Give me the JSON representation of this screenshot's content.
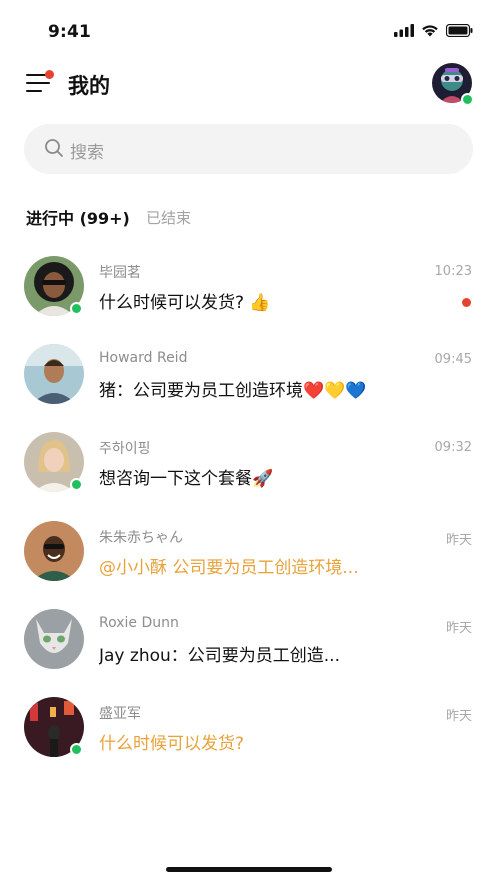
{
  "status_bar": {
    "time": "9:41",
    "icons": [
      "signal-icon",
      "wifi-icon",
      "battery-icon"
    ]
  },
  "header": {
    "title": "我的",
    "menu_icon": "menu-icon",
    "has_notification_dot": true,
    "avatar_online": true
  },
  "search": {
    "placeholder": "搜索",
    "icon": "search-icon"
  },
  "tabs": [
    {
      "label": "进行中 (99+)",
      "active": true
    },
    {
      "label": "已结束",
      "active": false
    }
  ],
  "chats": [
    {
      "name": "毕园茗",
      "message": "什么时候可以发货? 👍",
      "time": "10:23",
      "online": true,
      "unread": true,
      "message_color": "#111111"
    },
    {
      "name": "Howard Reid",
      "message": "猪：公司要为员工创造环境❤️💛💙",
      "time": "09:45",
      "online": false,
      "unread": false,
      "message_color": "#111111"
    },
    {
      "name": "주하이핑",
      "message": "想咨询一下这个套餐🚀",
      "time": "09:32",
      "online": true,
      "unread": false,
      "message_color": "#111111"
    },
    {
      "name": "朱朱赤ちゃん",
      "message": "@小小酥 公司要为员工创造环境...",
      "time": "昨天",
      "online": false,
      "unread": false,
      "message_color": "#e8a23a"
    },
    {
      "name": "Roxie Dunn",
      "message": "Jay zhou：公司要为员工创造...",
      "time": "昨天",
      "online": false,
      "unread": false,
      "message_color": "#111111"
    },
    {
      "name": "盛亚军",
      "message": "什么时候可以发货?",
      "time": "昨天",
      "online": true,
      "unread": false,
      "message_color": "#e8a23a"
    }
  ],
  "colors": {
    "accent": "#e8a23a",
    "online": "#20c05c",
    "notification": "#e4432f"
  }
}
